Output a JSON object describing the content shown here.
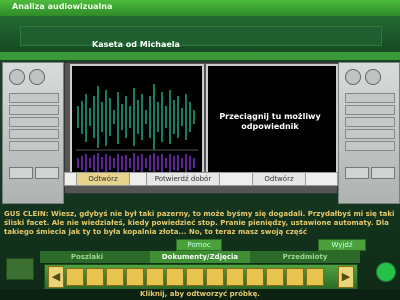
{
  "window": {
    "title": "Analiza audiowizualna"
  },
  "section": {
    "title": "Kaseta od Michaela"
  },
  "viewer": {
    "drop_hint": "Przeciągnij tu możliwy odpowiednik"
  },
  "buttons": {
    "left_play": "Odtwórz",
    "confirm": "Potwierdź dobór",
    "right_play": "Odtwórz"
  },
  "dialog": {
    "text": "GUS CLEIN: Wiesz, gdybyś nie był taki pazerny, to może byśmy się dogadali. Przydałbyś mi się taki śliski facet. Ale nie wiedziałeś, kiedy powiedzieć stop. Pranie pieniędzy, ustawione automaty. Dla takiego śmiecia jak ty to była kopalnia złota... No, to teraz masz swoją część"
  },
  "bottom_buttons": {
    "help": "Pomoc",
    "exit": "Wyjdź"
  },
  "tabs": [
    {
      "label": "Poszlaki"
    },
    {
      "label": "Dokumenty/Zdjęcia"
    },
    {
      "label": "Przedmioty"
    }
  ],
  "status": {
    "text": "Kliknij, aby odtworzyć próbkę."
  },
  "colors": {
    "title_green": "#3aa535",
    "accent_yellow": "#e7c96b",
    "panel_bg": "#000000"
  },
  "icons": {
    "home": "house-icon",
    "globe": "globe-icon",
    "arrow_left": "arrow-left-icon",
    "arrow_right": "arrow-right-icon"
  }
}
